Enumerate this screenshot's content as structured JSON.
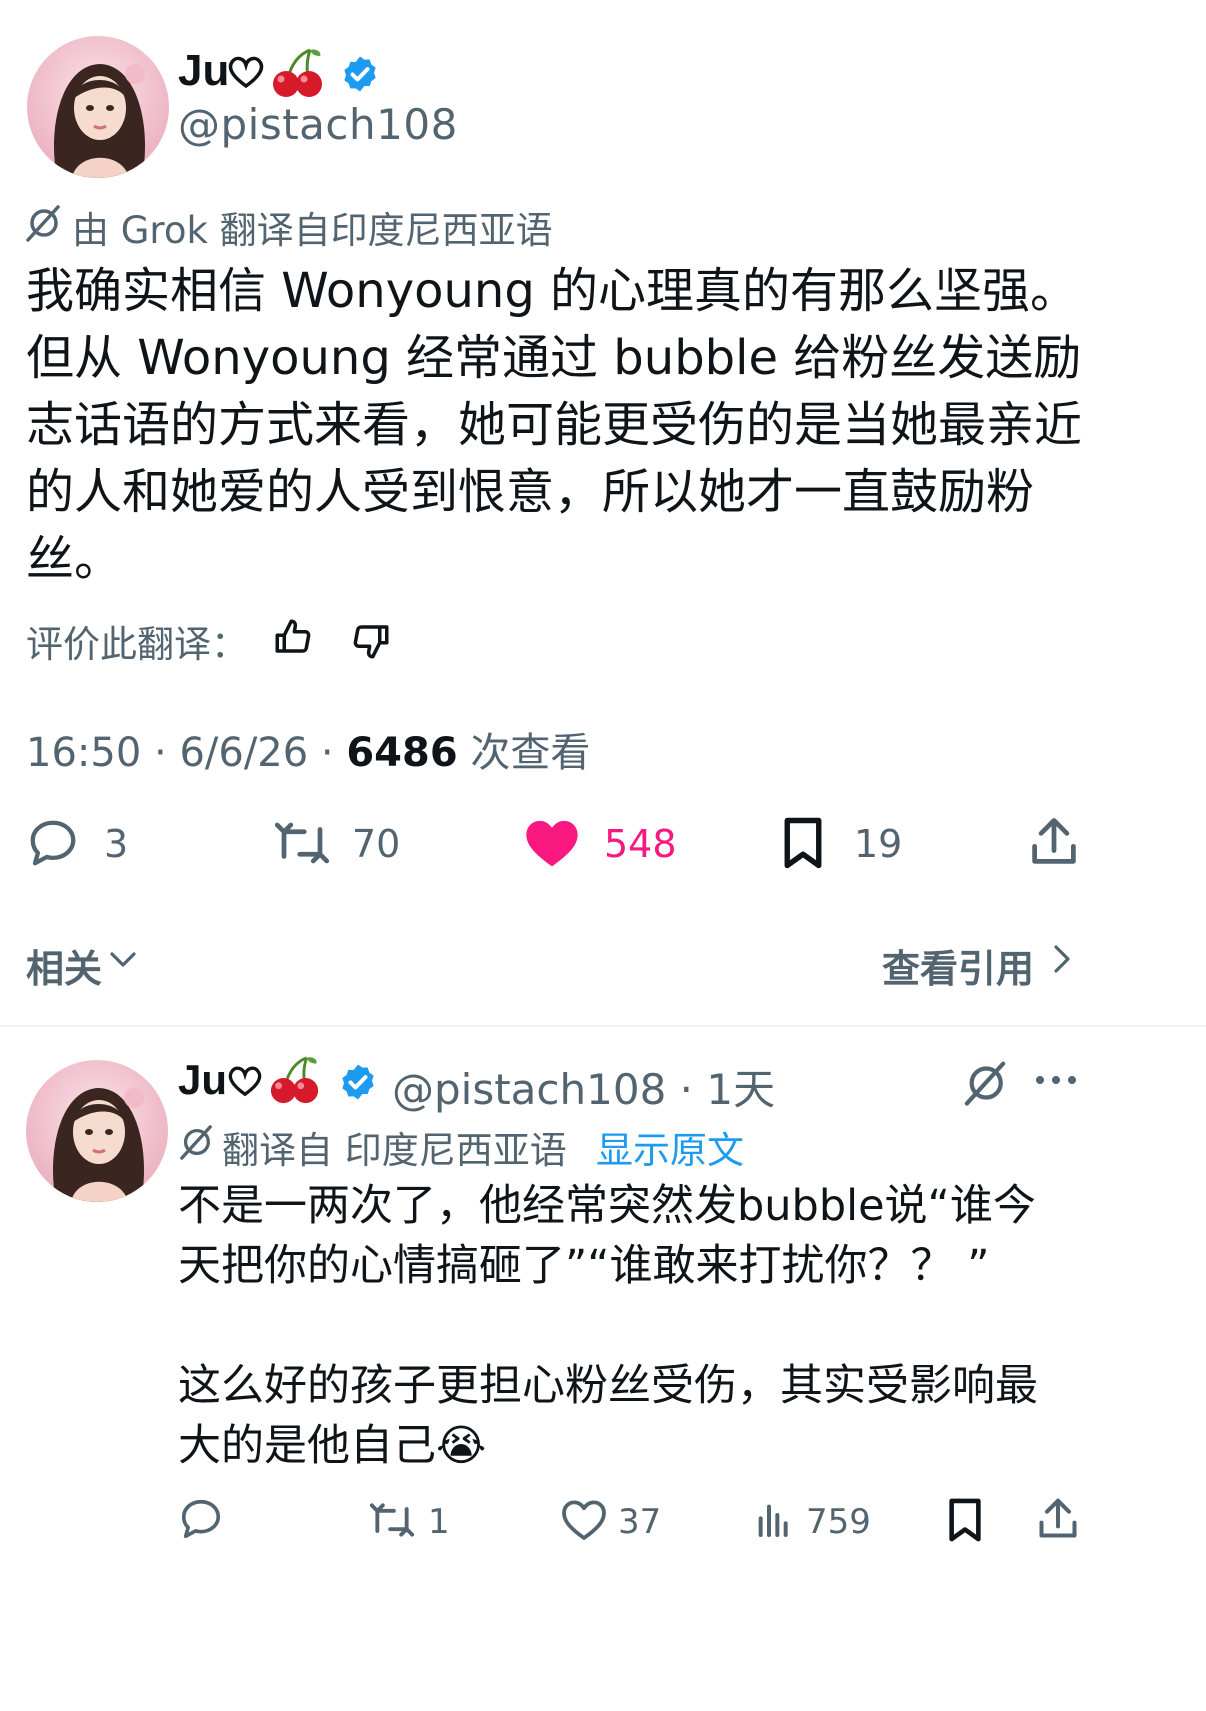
{
  "post": {
    "author_name": "Ju",
    "handle": "@pistach108",
    "translation_note": "由 Grok 翻译自印度尼西亚语",
    "body": "我确实相信 Wonyoung 的心理真的有那么坚强。但从 Wonyoung 经常通过 bubble 给粉丝发送励志话语的方式来看，她可能更受伤的是当她最亲近的人和她爱的人受到恨意，所以她才一直鼓励粉丝。",
    "rate_label": "评价此翻译：",
    "time": "16:50",
    "date": "6/6/26",
    "views_count": "6486",
    "views_label": "次查看",
    "separator": "·",
    "stats": {
      "replies": "3",
      "reposts": "70",
      "likes": "548",
      "bookmarks": "19"
    },
    "colors": {
      "like": "#f91880",
      "verified": "#1d9bf0"
    }
  },
  "related": {
    "label": "相关",
    "quotes_label": "查看引用"
  },
  "reply": {
    "author_name": "Ju",
    "handle": "@pistach108",
    "time": "1天",
    "separator": "·",
    "translation_prefix": "翻译自 印度尼西亚语",
    "show_original": "显示原文",
    "text_p1": "不是一两次了，他经常突然发bubble说“谁今天把你的心情搞砸了”“谁敢来打扰你？？ ”",
    "text_p2": "这么好的孩子更担心粉丝受伤，其实受影响最大的是他自己😭",
    "stats": {
      "replies": "",
      "reposts": "1",
      "likes": "37",
      "views": "759"
    }
  },
  "icons": [
    "heart-outline-icon",
    "cherry-icon",
    "verified-badge-icon",
    "translate-icon",
    "thumbs-up-icon",
    "thumbs-down-icon",
    "reply-icon",
    "repost-icon",
    "like-icon",
    "bookmark-icon",
    "share-icon",
    "chevron-down-icon",
    "chevron-right-icon",
    "more-icon",
    "views-icon",
    "crying-emoji-icon"
  ]
}
